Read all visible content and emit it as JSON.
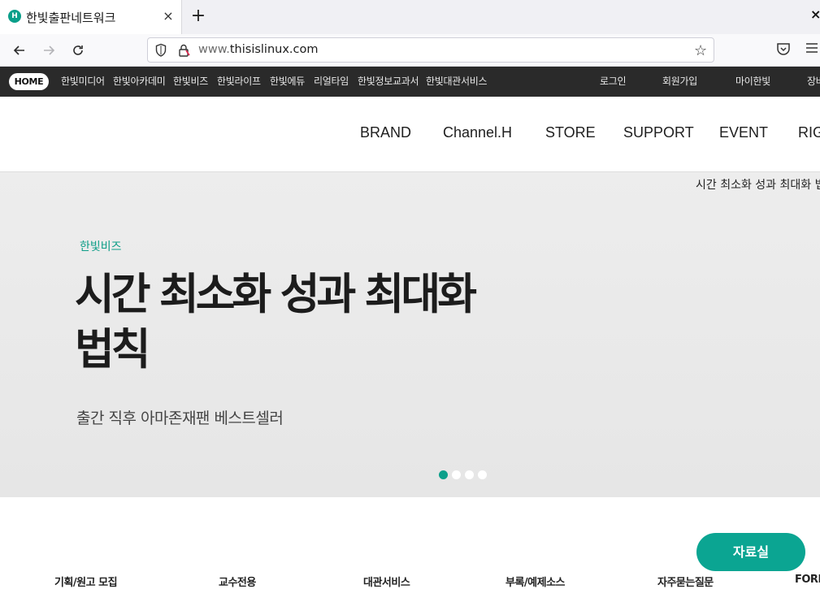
{
  "browser": {
    "tab_title": "한빛출판네트워크",
    "tab_close": "×",
    "new_tab": "+",
    "window_close": "×",
    "url_dim": "www.",
    "url_domain": "thisislinux.com",
    "icons": {
      "back": "arrow-left-icon",
      "forward": "arrow-right-icon",
      "reload": "reload-icon",
      "shield": "shield-icon",
      "lock": "lock-icon",
      "star": "star-icon",
      "pocket": "pocket-icon",
      "menu": "menu-icon"
    }
  },
  "topbar": {
    "home": "HOME",
    "links": [
      "한빛미디어",
      "한빛아카데미",
      "한빛비즈",
      "한빛라이프",
      "한빛에듀",
      "리얼타임",
      "한빛정보교과서",
      "한빛대관서비스"
    ],
    "login": "로그인",
    "signup": "회원가입",
    "my_hanbit": "마이한빛",
    "cart_partial": "장바"
  },
  "mainnav": {
    "items": [
      "BRAND",
      "Channel.H",
      "STORE",
      "SUPPORT",
      "EVENT",
      "RIG"
    ]
  },
  "hero": {
    "ticker": "시간 최소화 성과 최대화 법",
    "category": "한빛비즈",
    "headline_line1": "시간 최소화 성과 최대화",
    "headline_line2": "법칙",
    "subtitle": "출간 직후 아마존재팬 베스트셀러",
    "slide_count": 4,
    "active_slide": 1
  },
  "bottom": {
    "data_room": "자료실",
    "quick_links": [
      "기획/원고 모집",
      "교수전용",
      "대관서비스",
      "부록/예제소스",
      "자주묻는질문",
      "FORE"
    ]
  },
  "colors": {
    "accent": "#0b9f8a",
    "topbar_bg": "#2a2a2a",
    "hero_bg": "#ebebeb"
  }
}
